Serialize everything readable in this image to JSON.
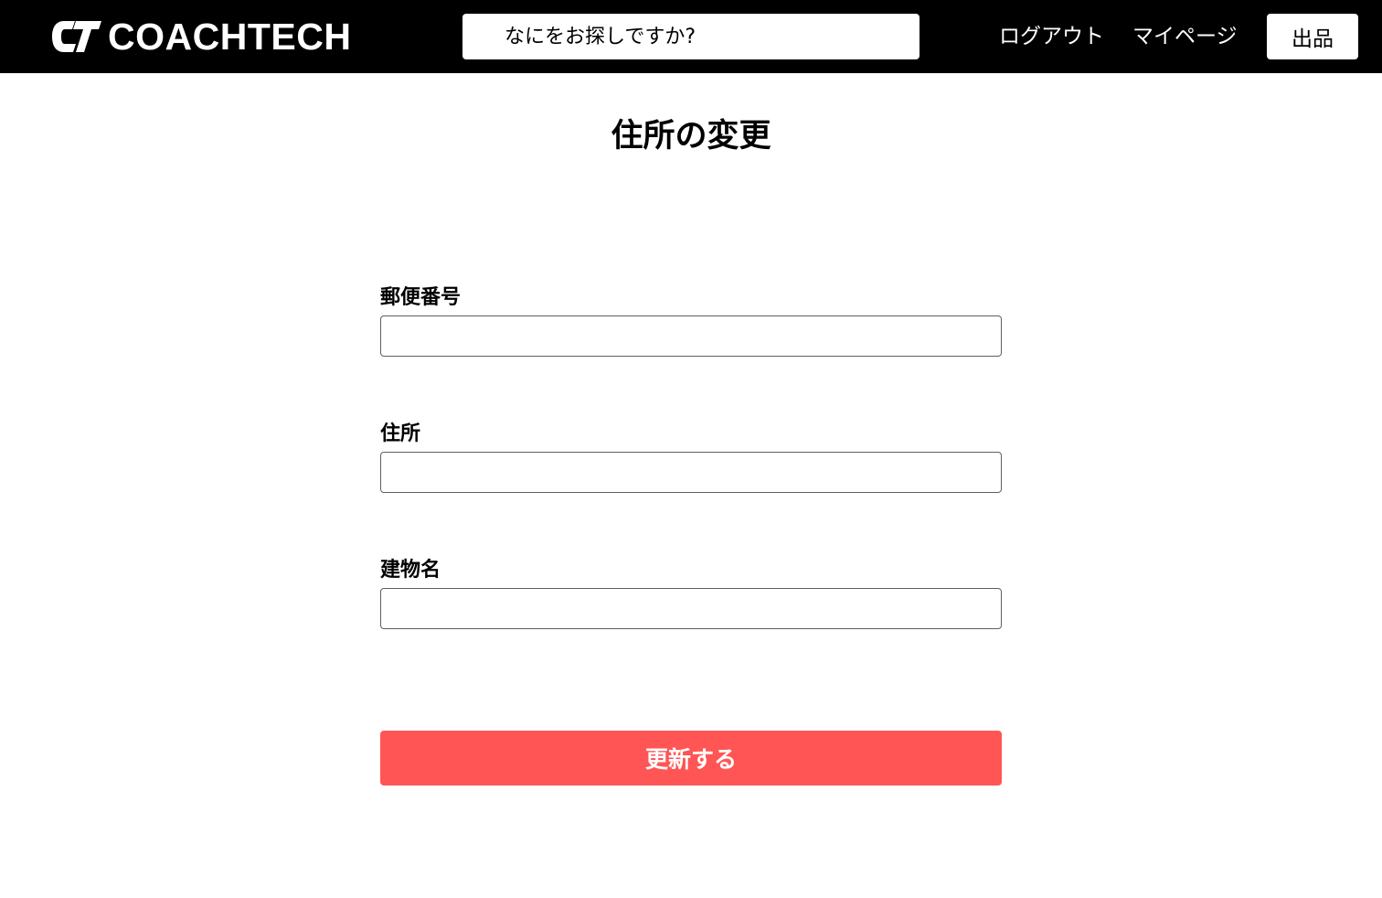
{
  "header": {
    "logo_text": "COACHTECH",
    "logo_icon": "coachtech-ct-logo",
    "search_placeholder": "なにをお探しですか?",
    "nav": {
      "logout": "ログアウト",
      "mypage": "マイページ"
    },
    "sell_button": "出品"
  },
  "main": {
    "title": "住所の変更",
    "fields": [
      {
        "label": "郵便番号",
        "value": ""
      },
      {
        "label": "住所",
        "value": ""
      },
      {
        "label": "建物名",
        "value": ""
      }
    ],
    "submit_label": "更新する"
  },
  "colors": {
    "header_background": "#000000",
    "primary_button": "#ff5555",
    "input_border": "#5f5f5f"
  }
}
